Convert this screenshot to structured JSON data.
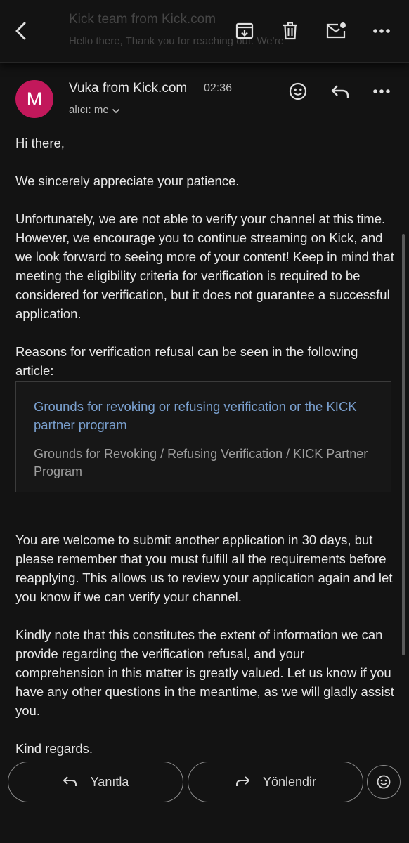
{
  "toolbar": {
    "ghost_subject": "Kick team from Kick.com",
    "ghost_snippet": "Hello there, Thank you for reaching out. We're",
    "back_icon": "arrow-back-icon",
    "archive_icon": "archive-icon",
    "delete_icon": "trash-icon",
    "mark_unread_icon": "mail-unread-icon",
    "more_icon": "more-vert-icon"
  },
  "message": {
    "avatar_letter": "M",
    "avatar_color": "#c2185b",
    "sender": "Vuka from Kick.com",
    "time": "02:36",
    "recipient_label": "alıcı: me",
    "react_icon": "emoji-icon",
    "reply_icon": "reply-icon",
    "more_icon": "more-horiz-icon"
  },
  "body": {
    "greeting": "Hi there,",
    "p1": "We sincerely appreciate your patience.",
    "p2": "Unfortunately, we are not able to verify your channel at this time. However, we encourage you to continue streaming on Kick, and we look forward to seeing more of your content! Keep in mind that meeting the eligibility criteria for verification is required to be considered for verification, but it does not guarantee a successful application.",
    "p3": "Reasons for verification refusal can be seen in the following article:",
    "link_card": {
      "title": "Grounds for revoking or refusing verification or the KICK partner program",
      "description": "Grounds for Revoking / Refusing Verification / KICK Partner Program"
    },
    "p4": "You are welcome to submit another application in 30 days, but please remember that you must fulfill all the requirements before reapplying. This allows us to review your application again and let you know if we can verify your channel.",
    "p5": "Kindly note that this constitutes the extent of information we can provide regarding the verification refusal, and your comprehension in this matter is greatly valued. Let us know if you have any other questions in the meantime, as we will gladly assist you.",
    "closing": "Kind regards."
  },
  "actions": {
    "reply_label": "Yanıtla",
    "forward_label": "Yönlendir",
    "react_icon": "emoji-icon"
  },
  "colors": {
    "background": "#131313",
    "link": "#7aa0cf",
    "avatar": "#c2185b"
  }
}
